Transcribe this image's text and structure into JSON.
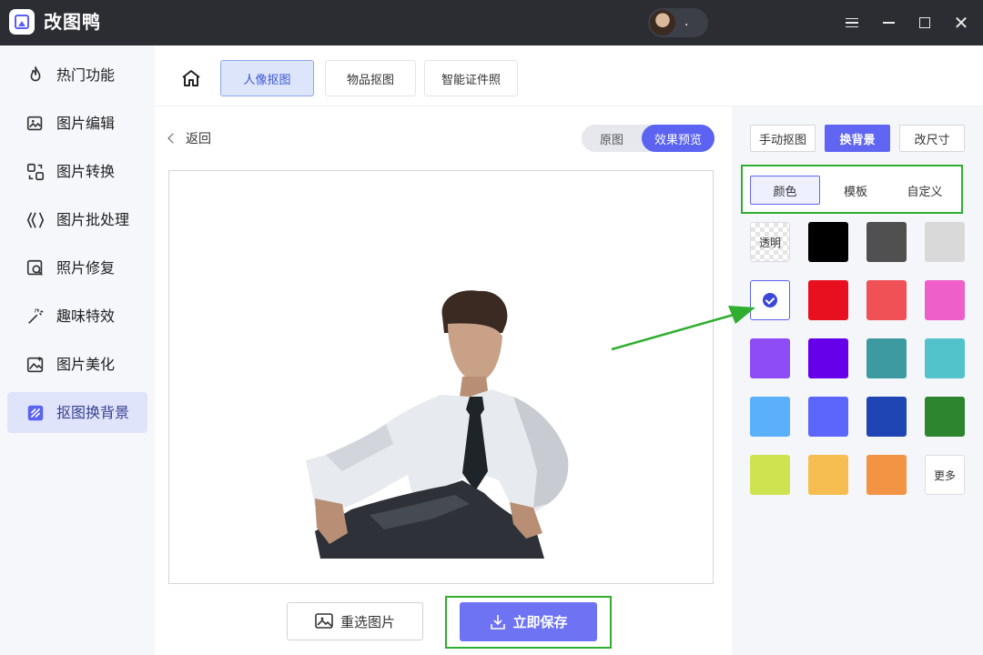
{
  "app": {
    "title": "改图鸭",
    "user_name": "."
  },
  "sidebar": {
    "items": [
      {
        "label": "热门功能",
        "icon": "fire-icon"
      },
      {
        "label": "图片编辑",
        "icon": "image-edit-icon"
      },
      {
        "label": "图片转换",
        "icon": "convert-icon"
      },
      {
        "label": "图片批处理",
        "icon": "batch-icon"
      },
      {
        "label": "照片修复",
        "icon": "repair-icon"
      },
      {
        "label": "趣味特效",
        "icon": "magic-wand-icon"
      },
      {
        "label": "图片美化",
        "icon": "beautify-icon"
      },
      {
        "label": "抠图换背景",
        "icon": "cutout-icon",
        "active": true
      }
    ]
  },
  "top_tabs": [
    {
      "label": "人像抠图",
      "active": true
    },
    {
      "label": "物品抠图"
    },
    {
      "label": "智能证件照"
    }
  ],
  "main": {
    "back_label": "返回",
    "view_toggle": {
      "original": "原图",
      "preview": "效果预览",
      "selected": "效果预览"
    },
    "reselect_label": "重选图片",
    "save_label": "立即保存"
  },
  "right_panel": {
    "mode_tabs": [
      {
        "label": "手动抠图"
      },
      {
        "label": "换背景",
        "active": true
      },
      {
        "label": "改尺寸"
      }
    ],
    "sub_tabs": [
      {
        "label": "颜色",
        "active": true
      },
      {
        "label": "模板"
      },
      {
        "label": "自定义"
      }
    ],
    "transparent_label": "透明",
    "more_label": "更多",
    "selected_color": "#ffffff",
    "colors": [
      [
        "transparent",
        "#000000",
        "#505050",
        "#d9d9d9"
      ],
      [
        "#ffffff",
        "#e8101e",
        "#ef5157",
        "#ef5fc9"
      ],
      [
        "#8e4cf6",
        "#6600ea",
        "#3d9aa0",
        "#52c3cb"
      ],
      [
        "#5ab0fb",
        "#5d66fb",
        "#1f45b5",
        "#2e8530"
      ],
      [
        "#cfe351",
        "#f6bd50",
        "#f39344",
        "more"
      ]
    ]
  },
  "colors": {
    "accent": "#6066f2",
    "highlight_box": "#2fae2f"
  }
}
